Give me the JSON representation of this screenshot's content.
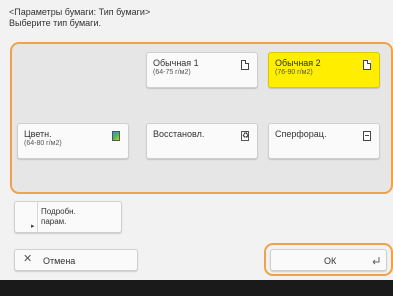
{
  "header": {
    "breadcrumb": "<Параметры бумаги: Тип бумаги>",
    "instruction": "Выберите тип бумаги."
  },
  "paper_types": [
    {
      "label": "Обычная 1",
      "sub": "(64-75 г/м2)",
      "icon": "plain-paper-icon",
      "selected": false
    },
    {
      "label": "Обычная 2",
      "sub": "(76-90 г/м2)",
      "icon": "plain-paper-icon",
      "selected": true
    },
    {
      "label": "Цветн.",
      "sub": "(64-80 г/м2)",
      "icon": "color-paper-icon",
      "selected": false
    },
    {
      "label": "Восстановл.",
      "sub": "",
      "icon": "recycled-paper-icon",
      "selected": false
    },
    {
      "label": "Сперфорац.",
      "sub": "",
      "icon": "prepunched-paper-icon",
      "selected": false
    }
  ],
  "details": {
    "line1": "Подробн.",
    "line2": "парам."
  },
  "cancel": {
    "label": "Отмена"
  },
  "ok": {
    "label": "ОК"
  },
  "colors": {
    "accent": "#f0a24a",
    "selected": "#ffee00"
  }
}
